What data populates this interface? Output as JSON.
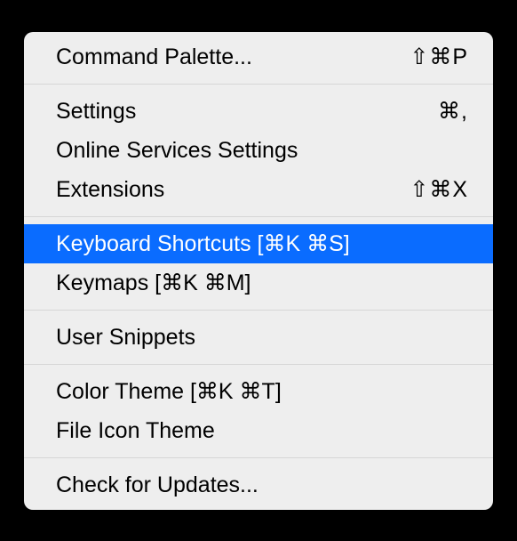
{
  "menu": {
    "groups": [
      [
        {
          "label": "Command Palette...",
          "shortcut": "⇧⌘P",
          "selected": false,
          "name": "menu-item-command-palette"
        }
      ],
      [
        {
          "label": "Settings",
          "shortcut": "⌘,",
          "selected": false,
          "name": "menu-item-settings"
        },
        {
          "label": "Online Services Settings",
          "shortcut": "",
          "selected": false,
          "name": "menu-item-online-services-settings"
        },
        {
          "label": "Extensions",
          "shortcut": "⇧⌘X",
          "selected": false,
          "name": "menu-item-extensions"
        }
      ],
      [
        {
          "label": "Keyboard Shortcuts [⌘K ⌘S]",
          "shortcut": "",
          "selected": true,
          "name": "menu-item-keyboard-shortcuts"
        },
        {
          "label": "Keymaps [⌘K ⌘M]",
          "shortcut": "",
          "selected": false,
          "name": "menu-item-keymaps"
        }
      ],
      [
        {
          "label": "User Snippets",
          "shortcut": "",
          "selected": false,
          "name": "menu-item-user-snippets"
        }
      ],
      [
        {
          "label": "Color Theme [⌘K ⌘T]",
          "shortcut": "",
          "selected": false,
          "name": "menu-item-color-theme"
        },
        {
          "label": "File Icon Theme",
          "shortcut": "",
          "selected": false,
          "name": "menu-item-file-icon-theme"
        }
      ],
      [
        {
          "label": "Check for Updates...",
          "shortcut": "",
          "selected": false,
          "name": "menu-item-check-for-updates"
        }
      ]
    ]
  }
}
